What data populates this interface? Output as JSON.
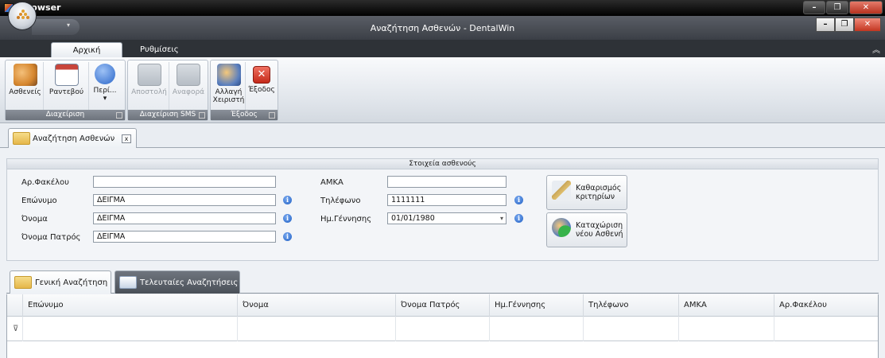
{
  "os": {
    "title": "browser"
  },
  "app": {
    "title": "Αναζήτηση Ασθενών - DentalWin"
  },
  "ribbon": {
    "tabs": [
      {
        "label": "Αρχική"
      },
      {
        "label": "Ρυθμίσεις"
      }
    ],
    "groups": [
      {
        "label": "Διαχείριση",
        "buttons": [
          {
            "label": "Ασθενείς"
          },
          {
            "label": "Ραντεβού"
          },
          {
            "label": "Περί..."
          }
        ]
      },
      {
        "label": "Διαχείριση SMS",
        "buttons": [
          {
            "label": "Αποστολή"
          },
          {
            "label": "Αναφορά"
          }
        ]
      },
      {
        "label": "Έξοδος",
        "buttons": [
          {
            "label": "Αλλαγή Χειριστή"
          },
          {
            "label": "Έξοδος"
          }
        ]
      }
    ]
  },
  "doc_tab": {
    "label": "Αναζήτηση Ασθενών",
    "close": "x"
  },
  "patient": {
    "header": "Στοιχεία ασθενούς",
    "folder_no": {
      "label": "Αρ.Φακέλου",
      "value": ""
    },
    "surname": {
      "label": "Επώνυμο",
      "value": "ΔΕΙΓΜΑ"
    },
    "name": {
      "label": "Όνομα",
      "value": "ΔΕΙΓΜΑ"
    },
    "father_name": {
      "label": "Όνομα Πατρός",
      "value": "ΔΕΙΓΜΑ"
    },
    "amka": {
      "label": "ΑΜΚΑ",
      "value": ""
    },
    "phone": {
      "label": "Τηλέφωνο",
      "value": "1111111"
    },
    "birth": {
      "label": "Ημ.Γέννησης",
      "value": "01/01/1980"
    },
    "info_glyph": "i",
    "clear_button": {
      "line1": "Καθαρισμός",
      "line2": "κριτηρίων"
    },
    "new_button": {
      "line1": "Καταχώριση",
      "line2": "νέου Ασθενή"
    }
  },
  "lower_tabs": [
    {
      "label": "Γενική Αναζήτηση"
    },
    {
      "label": "Τελευταίες Αναζητήσεις"
    }
  ],
  "grid": {
    "columns": [
      "Επώνυμο",
      "Όνομα",
      "Όνομα Πατρός",
      "Ημ.Γέννησης",
      "Τηλέφωνο",
      "ΑΜΚΑ",
      "Αρ.Φακέλου"
    ]
  },
  "colors": {
    "accent": "#1f5fc4",
    "ribbon_label": "#6d737c",
    "dark_bar": "#2e3237"
  }
}
